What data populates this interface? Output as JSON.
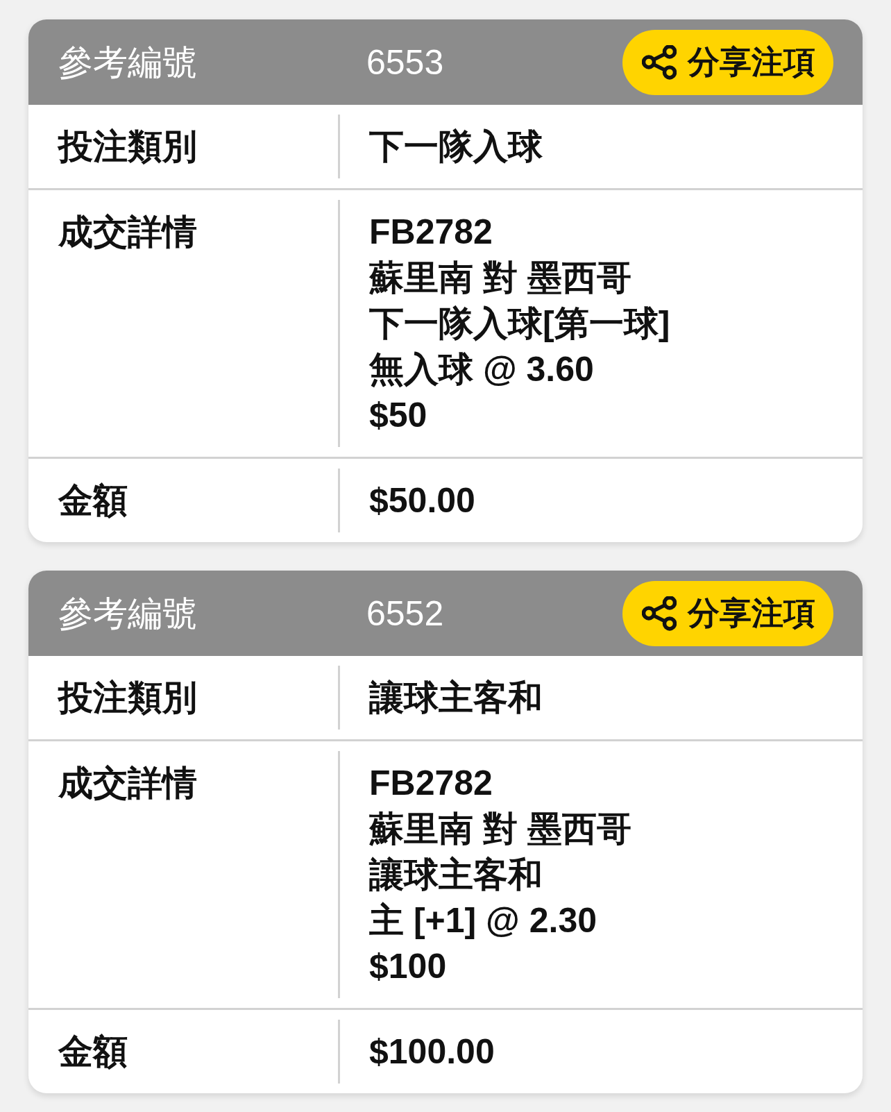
{
  "cards": [
    {
      "header": {
        "label": "參考編號",
        "value": "6553",
        "share_button": "分享注項"
      },
      "rows": [
        {
          "label": "投注類別",
          "lines": [
            "下一隊入球"
          ]
        },
        {
          "label": "成交詳情",
          "lines": [
            "FB2782",
            "蘇里南 對 墨西哥",
            "下一隊入球[第一球]",
            "無入球 @ 3.60",
            "$50"
          ]
        },
        {
          "label": "金額",
          "lines": [
            "$50.00"
          ]
        }
      ]
    },
    {
      "header": {
        "label": "參考編號",
        "value": "6552",
        "share_button": "分享注項"
      },
      "rows": [
        {
          "label": "投注類別",
          "lines": [
            "讓球主客和"
          ]
        },
        {
          "label": "成交詳情",
          "lines": [
            "FB2782",
            "蘇里南 對 墨西哥",
            "讓球主客和",
            "主 [+1] @ 2.30",
            "$100"
          ]
        },
        {
          "label": "金額",
          "lines": [
            "$100.00"
          ]
        }
      ]
    }
  ]
}
